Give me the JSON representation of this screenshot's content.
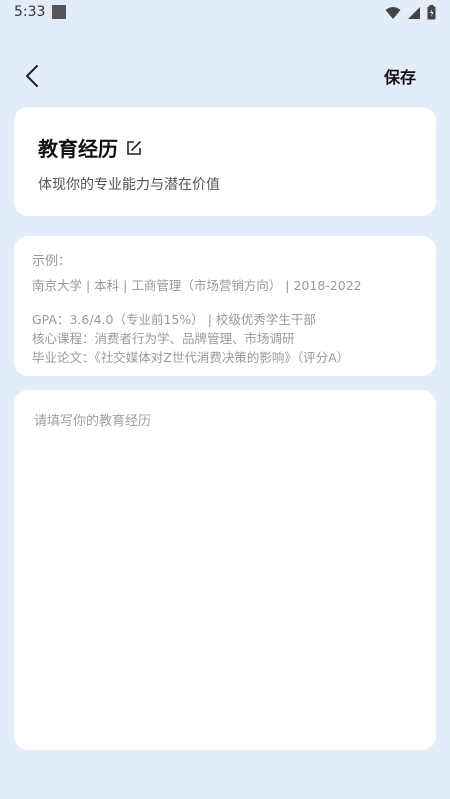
{
  "status_bar": {
    "time": "5:33",
    "icons": [
      "wifi-icon",
      "signal-icon",
      "battery-icon"
    ]
  },
  "header": {
    "back_icon": "chevron-left-icon",
    "save_label": "保存"
  },
  "title_card": {
    "title": "教育经历",
    "edit_icon": "edit-icon",
    "subtitle": "体现你的专业能力与潜在价值"
  },
  "example_card": {
    "label": "示例：",
    "lines": [
      "南京大学 | 本科 | 工商管理（市场营销方向） | 2018-2022",
      "GPA：3.6/4.0（专业前15%） | 校级优秀学生干部",
      "核心课程：消费者行为学、品牌管理、市场调研",
      "毕业论文：《社交媒体对Z世代消费决策的影响》（评分A）"
    ]
  },
  "input_card": {
    "value": "",
    "placeholder": "请填写你的教育经历"
  },
  "colors": {
    "background": "#e3ecf9",
    "card": "#ffffff",
    "muted_text": "#9a9a9a"
  }
}
